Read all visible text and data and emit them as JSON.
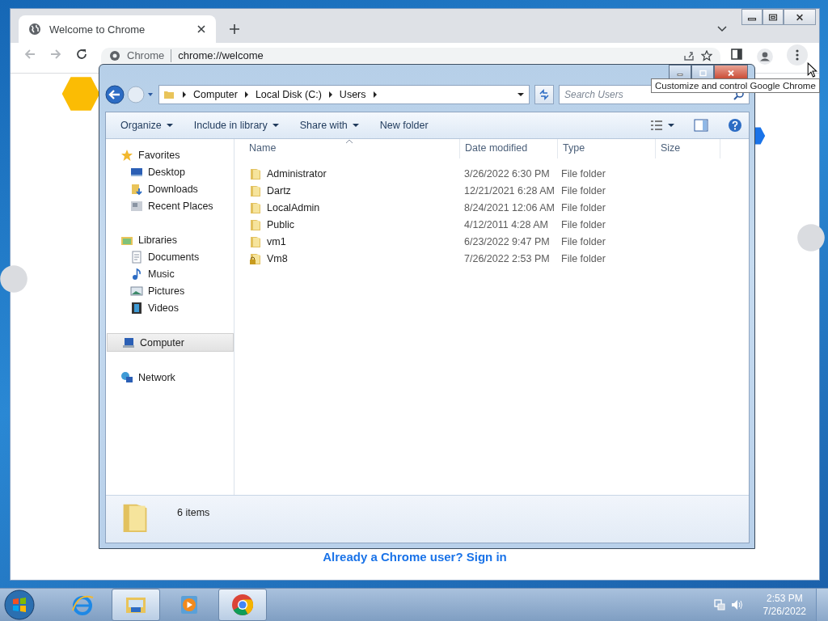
{
  "chrome": {
    "tab": {
      "title": "Welcome to Chrome",
      "selected": true
    },
    "omnibox": {
      "site": "Chrome",
      "url": "chrome://welcome"
    },
    "sign_in_link": "Already a Chrome user? Sign in",
    "tooltip": "Customize and control Google Chrome"
  },
  "explorer": {
    "breadcrumb": [
      "Computer",
      "Local Disk (C:)",
      "Users"
    ],
    "search": {
      "placeholder": "Search Users"
    },
    "toolbar": [
      {
        "label": "Organize",
        "dropdown": true
      },
      {
        "label": "Include in library",
        "dropdown": true
      },
      {
        "label": "Share with",
        "dropdown": true
      },
      {
        "label": "New folder",
        "dropdown": false
      }
    ],
    "nav": [
      {
        "label": "Favorites",
        "kind": "star",
        "selected": false,
        "children": [
          {
            "label": "Desktop",
            "kind": "desktop",
            "selected": false
          },
          {
            "label": "Downloads",
            "kind": "downloads",
            "selected": false
          },
          {
            "label": "Recent Places",
            "kind": "recent",
            "selected": false
          }
        ]
      },
      {
        "label": "Libraries",
        "kind": "library",
        "selected": false,
        "children": [
          {
            "label": "Documents",
            "kind": "document",
            "selected": false
          },
          {
            "label": "Music",
            "kind": "music",
            "selected": false
          },
          {
            "label": "Pictures",
            "kind": "pictures",
            "selected": false
          },
          {
            "label": "Videos",
            "kind": "videos",
            "selected": false
          }
        ]
      },
      {
        "label": "Computer",
        "kind": "computer",
        "selected": true
      },
      {
        "label": "Network",
        "kind": "network",
        "selected": false
      }
    ],
    "columns": [
      "Name",
      "Date modified",
      "Type",
      "Size"
    ],
    "rows": [
      {
        "name": "Administrator",
        "date": "3/26/2022 6:30 PM",
        "type": "File folder",
        "kind": "folder"
      },
      {
        "name": "Dartz",
        "date": "12/21/2021 6:28 AM",
        "type": "File folder",
        "kind": "folder"
      },
      {
        "name": "LocalAdmin",
        "date": "8/24/2021 12:06 AM",
        "type": "File folder",
        "kind": "folder"
      },
      {
        "name": "Public",
        "date": "4/12/2011 4:28 AM",
        "type": "File folder",
        "kind": "folder"
      },
      {
        "name": "vm1",
        "date": "6/23/2022 9:47 PM",
        "type": "File folder",
        "kind": "folder"
      },
      {
        "name": "Vm8",
        "date": "7/26/2022 2:53 PM",
        "type": "File folder",
        "kind": "locked"
      }
    ],
    "status": "6 items"
  },
  "taskbar": {
    "apps": [
      {
        "kind": "browser-e",
        "open": false
      },
      {
        "kind": "files",
        "open": true
      },
      {
        "kind": "media",
        "open": false
      },
      {
        "kind": "chrome",
        "open": true
      }
    ],
    "clock": {
      "time": "2:53 PM",
      "date": "7/26/2022"
    }
  }
}
